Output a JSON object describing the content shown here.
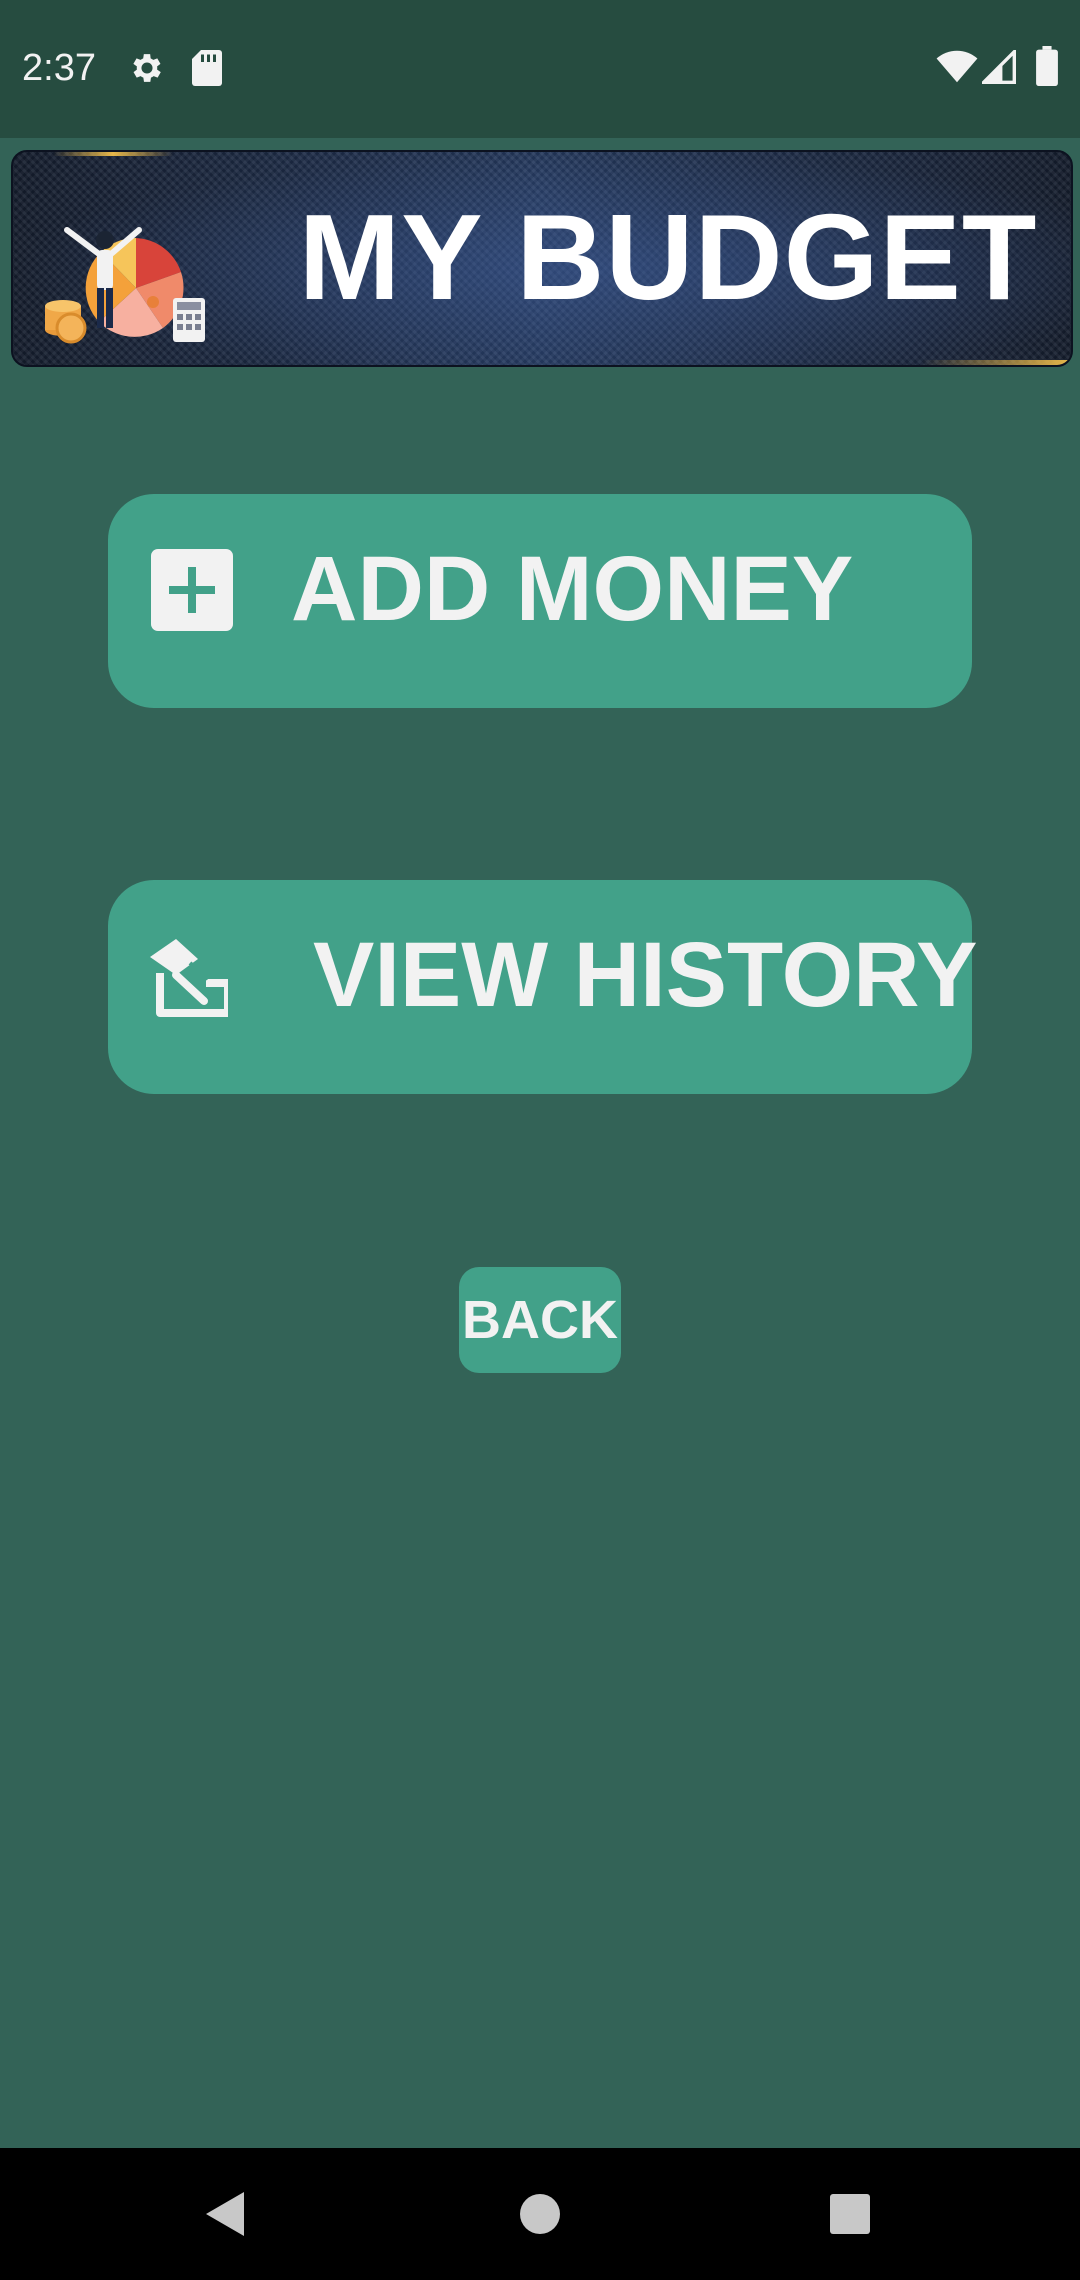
{
  "status_bar": {
    "time": "2:37",
    "left_icons": [
      "settings-icon",
      "sd-card-icon"
    ],
    "right_icons": [
      "wifi-icon",
      "cell-signal-icon",
      "battery-icon"
    ]
  },
  "banner": {
    "title": "MY BUDGET",
    "logo": "budget-illustration-icon"
  },
  "buttons": {
    "add_money": {
      "label": "ADD MONEY",
      "icon": "plus-box-icon"
    },
    "view_history": {
      "label": "VIEW HISTORY",
      "icon": "history-icon"
    },
    "back": {
      "label": "BACK"
    }
  },
  "nav_bar": {
    "items": [
      "back-triangle-icon",
      "home-circle-icon",
      "recents-square-icon"
    ]
  },
  "colors": {
    "background": "#336357",
    "status_bar": "#264c40",
    "button": "#42a189",
    "button_text": "#f2f2f2",
    "nav_bar": "#000000"
  }
}
